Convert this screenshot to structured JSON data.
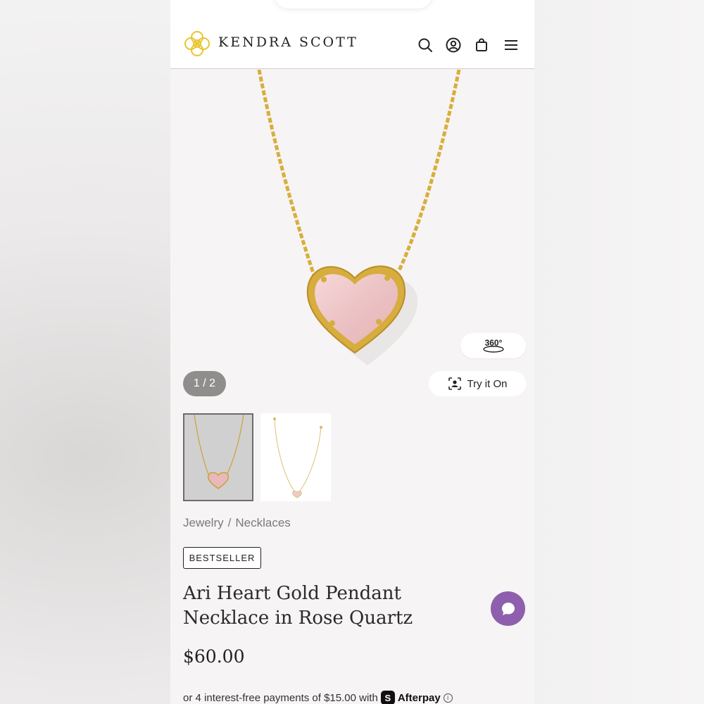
{
  "brand": {
    "name": "KENDRA SCOTT"
  },
  "header": {
    "icons": [
      "search-icon",
      "account-icon",
      "bag-icon",
      "menu-icon"
    ]
  },
  "gallery": {
    "counter": "1 / 2",
    "view_360_label": "360°",
    "try_on_label": "Try it On"
  },
  "breadcrumb": {
    "items": [
      "Jewelry",
      "Necklaces"
    ],
    "separator": "/"
  },
  "product": {
    "badge": "BESTSELLER",
    "title": "Ari Heart Gold Pendant Necklace in Rose Quartz",
    "price": "$60.00",
    "afterpay_text": "or 4 interest-free payments of $15.00 with",
    "afterpay_brand": "Afterpay",
    "afterpay_logo_letter": "S"
  },
  "colors": {
    "brand_gold": "#e8c62d",
    "chat_purple": "#8e5fad",
    "stone_pink": "#f0c9cb",
    "metal_gold": "#d4a93a"
  }
}
